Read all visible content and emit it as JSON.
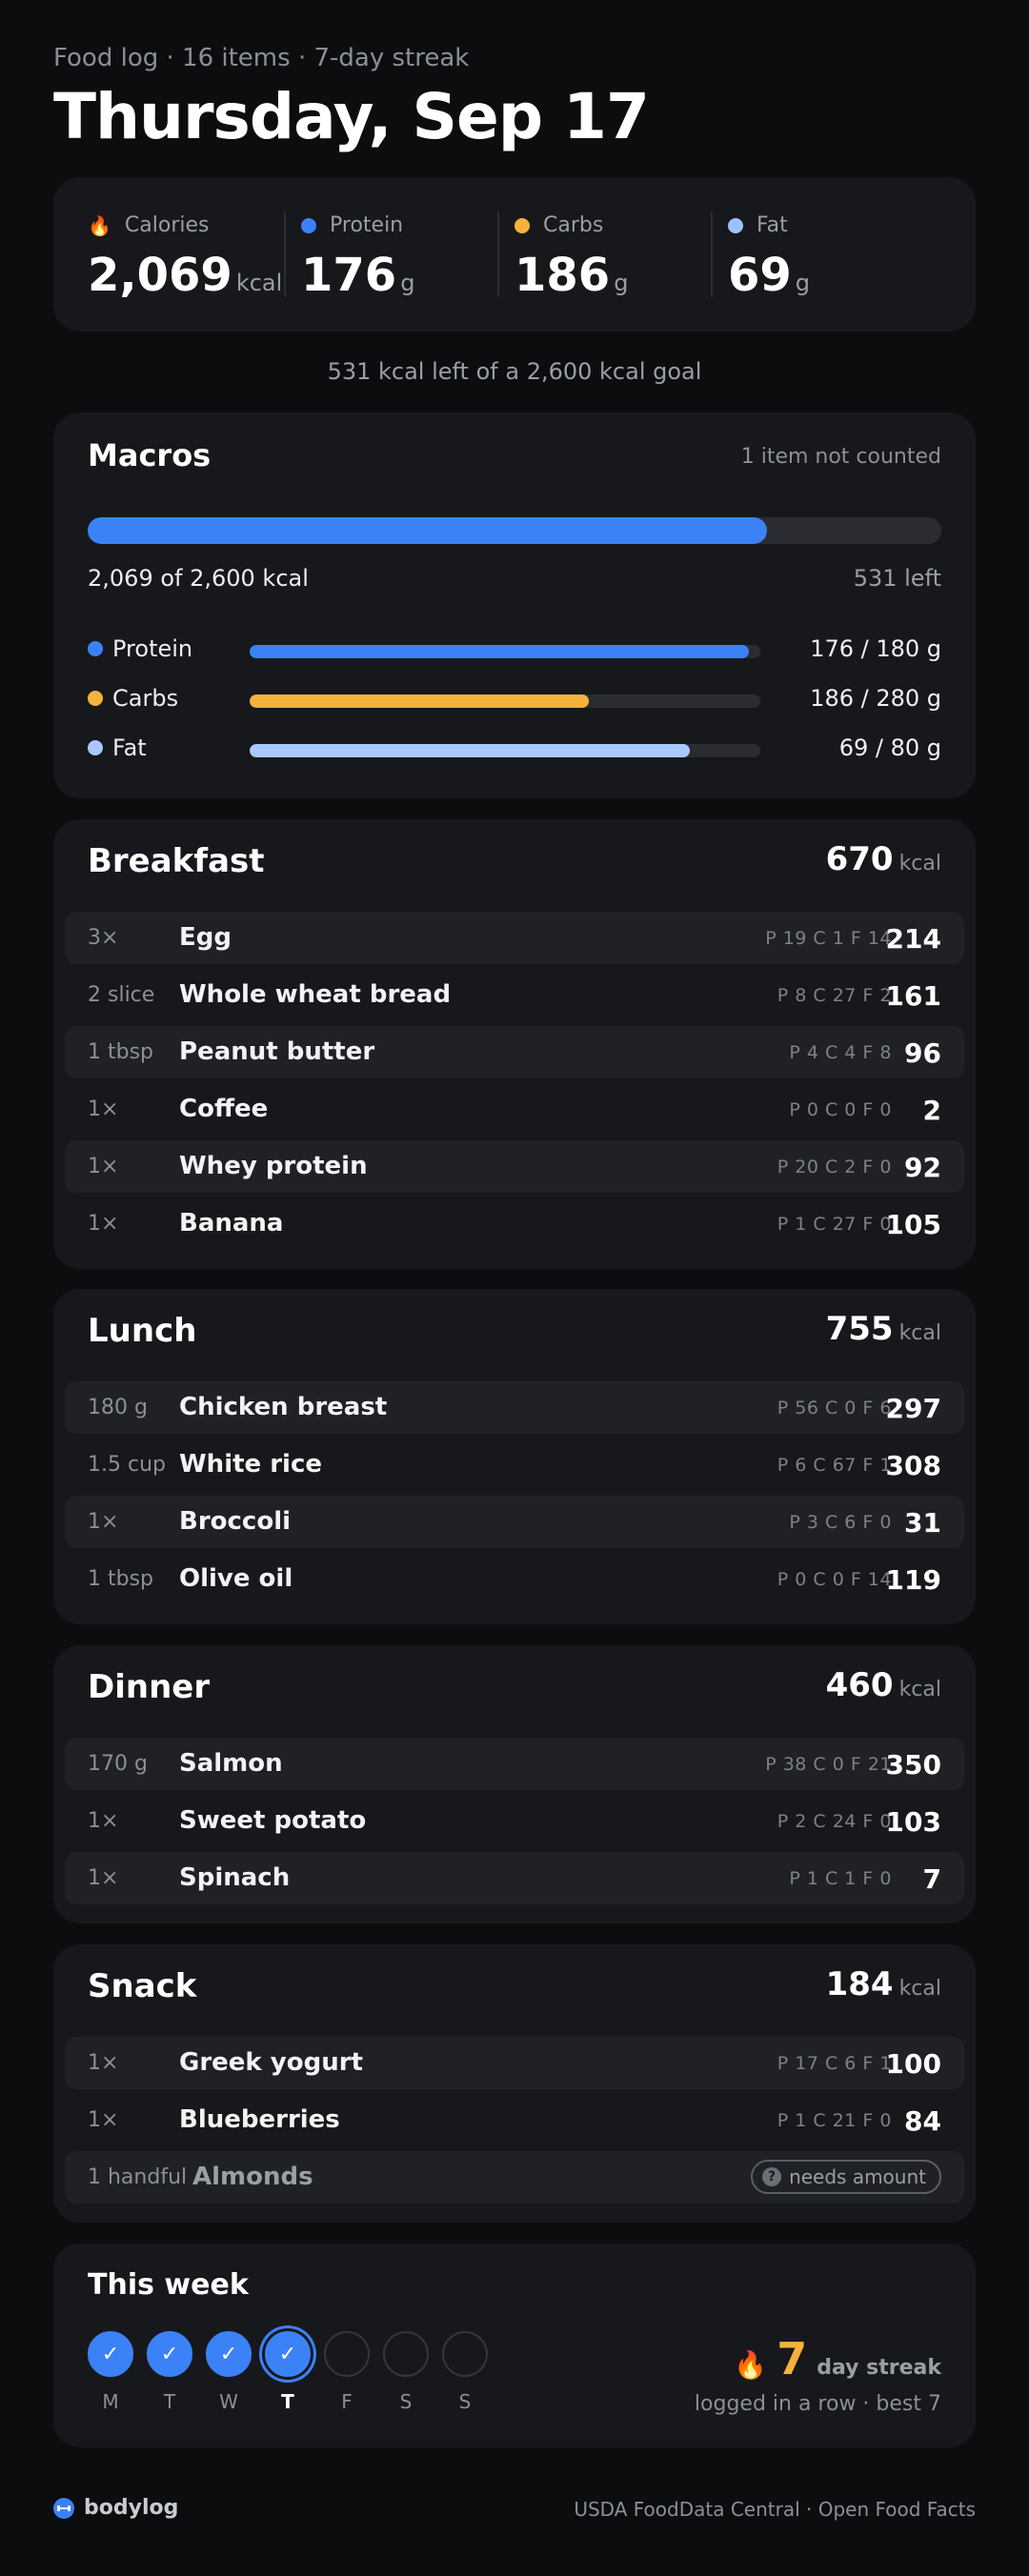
{
  "header": {
    "subline": "Food log · 16 items · 7-day streak",
    "date_title": "Thursday, Sep 17"
  },
  "summary": {
    "calories": {
      "label": "Calories",
      "value": "2,069",
      "unit": "kcal",
      "icon": "flame-icon"
    },
    "protein": {
      "label": "Protein",
      "value": "176",
      "unit": "g",
      "color": "#3b82f6"
    },
    "carbs": {
      "label": "Carbs",
      "value": "186",
      "unit": "g",
      "color": "#f5b23c"
    },
    "fat": {
      "label": "Fat",
      "value": "69",
      "unit": "g",
      "color": "#9cc3ff"
    },
    "remaining_text": "531 kcal left of a 2,600 kcal goal"
  },
  "macros": {
    "title": "Macros",
    "note": "1 item not counted",
    "calorie_progress": 0.796,
    "kcal_line": "2,069 of 2,600 kcal",
    "kcal_left": "531 left",
    "rows": [
      {
        "label": "Protein",
        "value": "176 / 180 g",
        "progress": 0.978,
        "color": "#3b82f6"
      },
      {
        "label": "Carbs",
        "value": "186 / 280 g",
        "progress": 0.664,
        "color": "#f5b23c"
      },
      {
        "label": "Fat",
        "value": "69 / 80 g",
        "progress": 0.8625,
        "color": "#a9c8fb"
      }
    ]
  },
  "meals": {
    "breakfast": {
      "title": "Breakfast",
      "kcal": "670",
      "unit": "kcal",
      "items": [
        {
          "qty": "3×",
          "name": "Egg",
          "macros": "P 19  C 1  F 14",
          "kcal": "214"
        },
        {
          "qty": "2 slice",
          "name": "Whole wheat bread",
          "macros": "P 8  C 27  F 2",
          "kcal": "161"
        },
        {
          "qty": "1 tbsp",
          "name": "Peanut butter",
          "macros": "P 4  C 4  F 8",
          "kcal": "96"
        },
        {
          "qty": "1×",
          "name": "Coffee",
          "macros": "P 0  C 0  F 0",
          "kcal": "2"
        },
        {
          "qty": "1×",
          "name": "Whey protein",
          "macros": "P 20  C 2  F 0",
          "kcal": "92"
        },
        {
          "qty": "1×",
          "name": "Banana",
          "macros": "P 1  C 27  F 0",
          "kcal": "105"
        }
      ]
    },
    "lunch": {
      "title": "Lunch",
      "kcal": "755",
      "unit": "kcal",
      "items": [
        {
          "qty": "180 g",
          "name": "Chicken breast",
          "macros": "P 56  C 0  F 6",
          "kcal": "297"
        },
        {
          "qty": "1.5 cup",
          "name": "White rice",
          "macros": "P 6  C 67  F 1",
          "kcal": "308"
        },
        {
          "qty": "1×",
          "name": "Broccoli",
          "macros": "P 3  C 6  F 0",
          "kcal": "31"
        },
        {
          "qty": "1 tbsp",
          "name": "Olive oil",
          "macros": "P 0  C 0  F 14",
          "kcal": "119"
        }
      ]
    },
    "dinner": {
      "title": "Dinner",
      "kcal": "460",
      "unit": "kcal",
      "items": [
        {
          "qty": "170 g",
          "name": "Salmon",
          "macros": "P 38  C 0  F 21",
          "kcal": "350"
        },
        {
          "qty": "1×",
          "name": "Sweet potato",
          "macros": "P 2  C 24  F 0",
          "kcal": "103"
        },
        {
          "qty": "1×",
          "name": "Spinach",
          "macros": "P 1  C 1  F 0",
          "kcal": "7"
        }
      ]
    },
    "snack": {
      "title": "Snack",
      "kcal": "184",
      "unit": "kcal",
      "items": [
        {
          "qty": "1×",
          "name": "Greek yogurt",
          "macros": "P 17  C 6  F 1",
          "kcal": "100"
        },
        {
          "qty": "1×",
          "name": "Blueberries",
          "macros": "P 1  C 21  F 0",
          "kcal": "84"
        },
        {
          "qty": "1 handful",
          "name": "Almonds",
          "badge": "needs amount"
        }
      ]
    }
  },
  "week": {
    "title": "This week",
    "days": [
      {
        "label": "M",
        "state": "done"
      },
      {
        "label": "T",
        "state": "done"
      },
      {
        "label": "W",
        "state": "done"
      },
      {
        "label": "T",
        "state": "today"
      },
      {
        "label": "F",
        "state": "empty"
      },
      {
        "label": "S",
        "state": "empty"
      },
      {
        "label": "S",
        "state": "empty"
      }
    ],
    "streak_number": "7",
    "streak_label": "day streak",
    "streak_sub": "logged in a row · best 7"
  },
  "footer": {
    "brand": "bodylog",
    "sources": "USDA FoodData Central · Open Food Facts"
  }
}
